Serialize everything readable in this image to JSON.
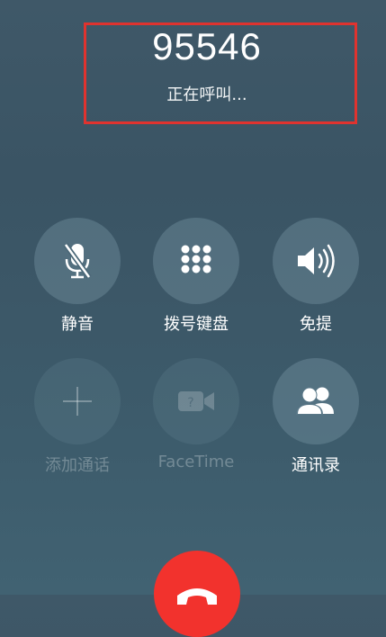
{
  "call": {
    "number": "95546",
    "status": "正在呼叫..."
  },
  "buttons": {
    "mute": {
      "label": "静音",
      "icon": "microphone-muted-icon"
    },
    "keypad": {
      "label": "拨号键盘",
      "icon": "keypad-icon"
    },
    "speaker": {
      "label": "免提",
      "icon": "speaker-icon"
    },
    "add_call": {
      "label": "添加通话",
      "icon": "plus-icon"
    },
    "facetime": {
      "label": "FaceTime",
      "icon": "video-camera-icon"
    },
    "contacts": {
      "label": "通讯录",
      "icon": "contacts-icon"
    }
  },
  "colors": {
    "highlight_border": "#e0332f",
    "end_call": "#f2322d"
  }
}
